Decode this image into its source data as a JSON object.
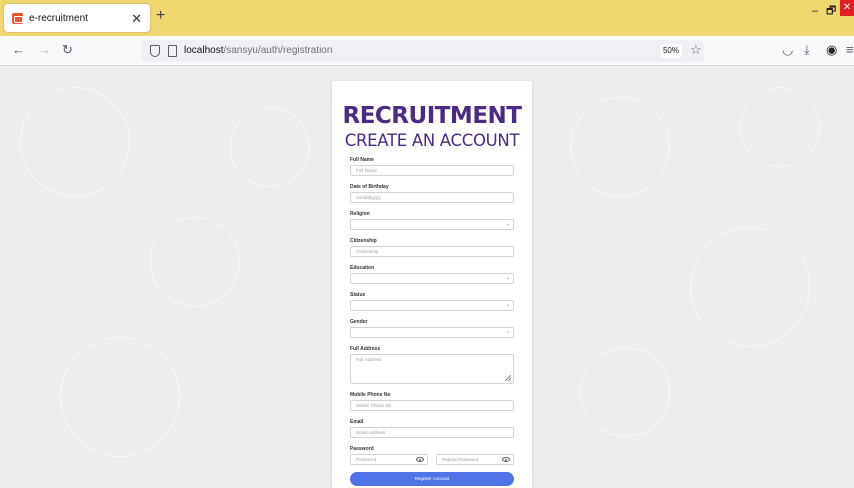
{
  "browser": {
    "tab_title": "e-recruitment",
    "tab_close": "✕",
    "new_tab": "+",
    "url_host": "localhost",
    "url_path": "/sansyu/auth/registration",
    "zoom": "50%",
    "win_minimize": "–",
    "win_restore": "🗗",
    "win_close": "✕",
    "back": "←",
    "forward": "→",
    "reload": "↻",
    "star": "☆",
    "pocket": "◡",
    "download": "⤓",
    "account": "◉",
    "menu": "≡"
  },
  "form": {
    "title": "RECRUITMENT",
    "subtitle": "CREATE AN ACCOUNT",
    "full_name": {
      "label": "Full Name",
      "placeholder": "Full Name"
    },
    "dob": {
      "label": "Date of Birthday",
      "placeholder": "mm/dd/yyyy"
    },
    "religion": {
      "label": "Religion",
      "value": ""
    },
    "citizenship": {
      "label": "Citizenship",
      "placeholder": "Citizenship"
    },
    "education": {
      "label": "Education",
      "value": ""
    },
    "status": {
      "label": "Status",
      "value": ""
    },
    "gender": {
      "label": "Gender",
      "value": ""
    },
    "address": {
      "label": "Full Address",
      "placeholder": "Full Address"
    },
    "phone": {
      "label": "Mobile Phone No",
      "placeholder": "Mobile Phone No"
    },
    "email": {
      "label": "Email",
      "placeholder": "Email Address"
    },
    "password": {
      "label": "Password",
      "placeholder": "Password",
      "repeat_placeholder": "Repeat Password"
    },
    "submit": "Register Account",
    "select_arrow": "⌄"
  },
  "colors": {
    "accent": "#4b2b86",
    "button": "#4e74e8",
    "tabstrip": "#efd86f",
    "close": "#e02020"
  }
}
